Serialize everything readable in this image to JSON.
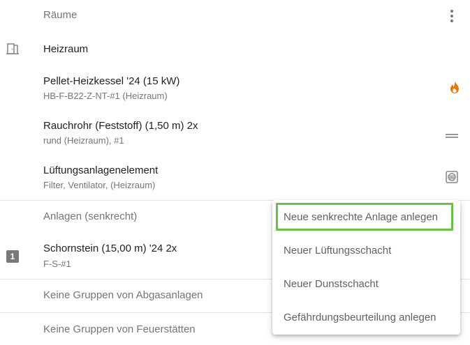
{
  "rooms_section": {
    "header": "Räume",
    "more_icon": "more-vert-icon"
  },
  "room": {
    "name": "Heizraum",
    "icon": "door-icon"
  },
  "items": [
    {
      "title": "Pellet-Heizkessel '24 (15 kW)",
      "subtitle": "HB-F-B22-Z-NT-#1 (Heizraum)",
      "icon": "flame-icon",
      "icon_color": "#e07a10"
    },
    {
      "title": "Rauchrohr (Feststoff) (1,50 m) 2x",
      "subtitle": "rund (Heizraum), #1",
      "icon": "pipe-icon"
    },
    {
      "title": "Lüftungsanlagenelement",
      "subtitle": "Filter, Ventilator, (Heizraum)",
      "icon": "ventilation-icon"
    }
  ],
  "systems_section": {
    "header": "Anlagen (senkrecht)"
  },
  "chimney": {
    "badge": "1",
    "title": "Schornstein (15,00 m) '24 2x",
    "subtitle": "F-S-#1"
  },
  "empty_groups": [
    "Keine Gruppen von Abgasanlagen",
    "Keine Gruppen von Feuerstätten"
  ],
  "context_menu": {
    "items": [
      "Neue senkrechte Anlage anlegen",
      "Neuer Lüftungsschacht",
      "Neuer Dunstschacht",
      "Gefährdungsbeurteilung anlegen"
    ],
    "highlight_color": "#6cc04a"
  }
}
